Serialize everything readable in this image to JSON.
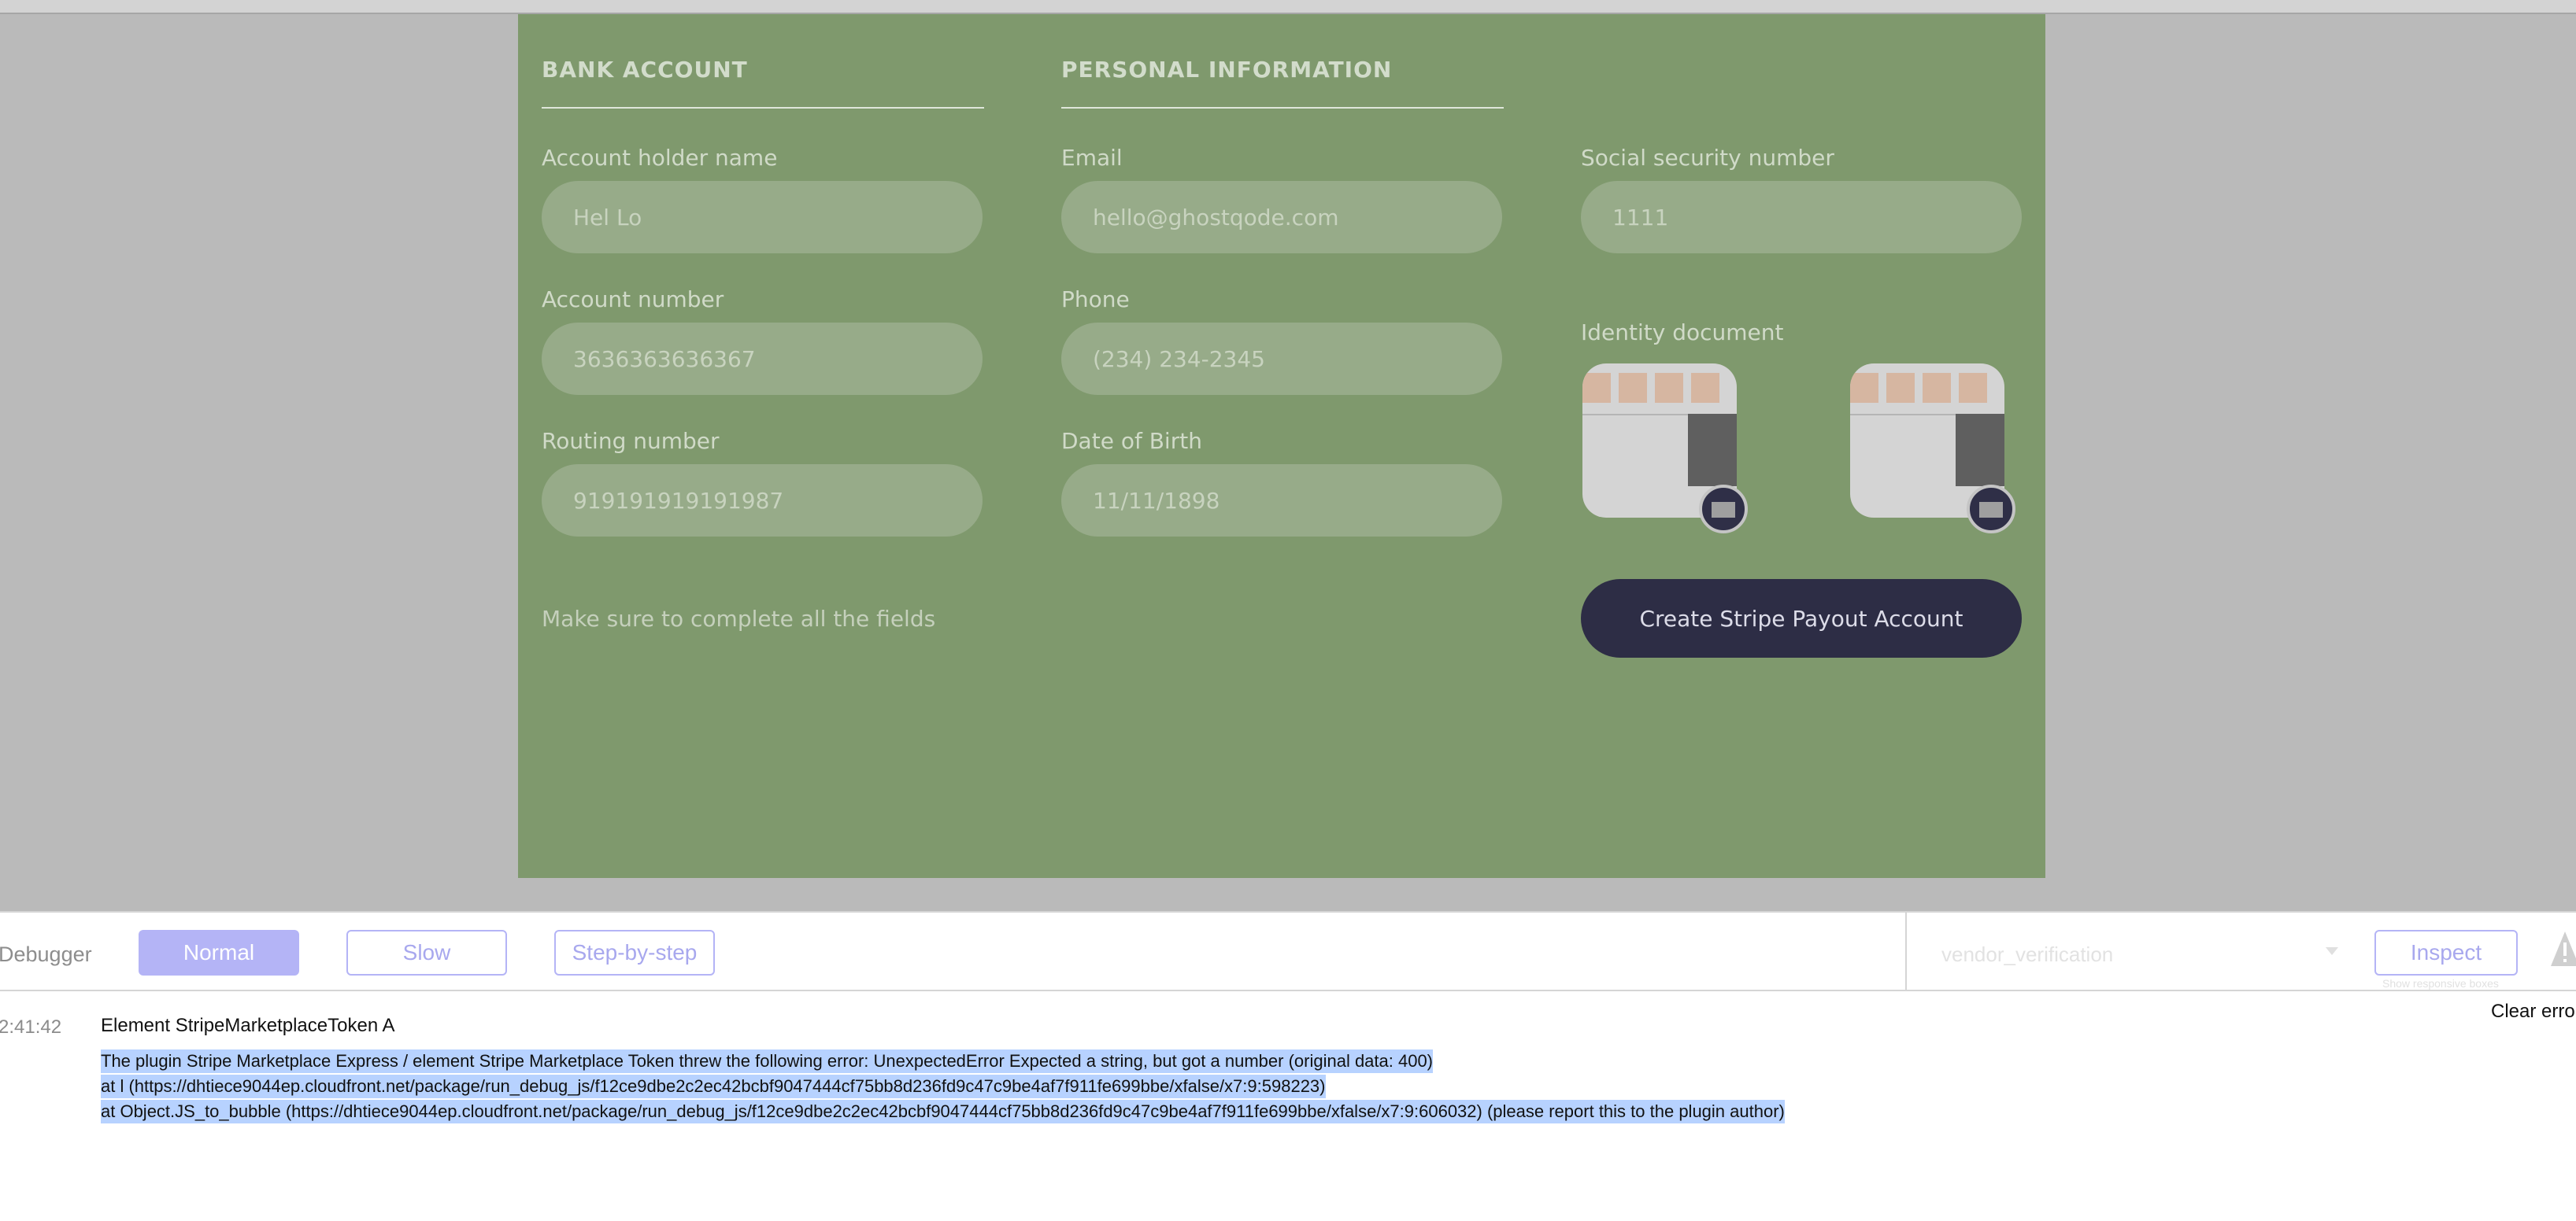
{
  "bank_account": {
    "title": "BANK ACCOUNT",
    "holder_label": "Account holder name",
    "holder_value": "Hel Lo",
    "account_label": "Account number",
    "account_value": "3636363636367",
    "routing_label": "Routing number",
    "routing_value": "919191919191987"
  },
  "personal_information": {
    "title": "PERSONAL INFORMATION",
    "email_label": "Email",
    "email_value": "hello@ghostqode.com",
    "phone_label": "Phone",
    "phone_value": "(234) 234-2345",
    "dob_label": "Date of Birth",
    "dob_value": "11/11/1898"
  },
  "identity": {
    "ssn_label": "Social security number",
    "ssn_value": "1111",
    "document_label": "Identity document"
  },
  "form": {
    "hint": "Make sure to complete all the fields",
    "submit_label": "Create Stripe Payout Account"
  },
  "debugger": {
    "title": "Debugger",
    "normal": "Normal",
    "slow": "Slow",
    "step": "Step-by-step",
    "element": "vendor_verification",
    "inspect": "Inspect",
    "responsive": "Show responsive boxes",
    "clear": "Clear errors"
  },
  "log": {
    "time": "2:41:42",
    "title": "Element StripeMarketplaceToken A",
    "line1": "The plugin Stripe Marketplace Express / element Stripe Marketplace Token threw the following error: UnexpectedError Expected a string, but got a number (original data: 400)",
    "line2": "    at l (https://dhtiece9044ep.cloudfront.net/package/run_debug_js/f12ce9dbe2c2ec42bcbf9047444cf75bb8d236fd9c47c9be4af7f911fe699bbe/xfalse/x7:9:598223)",
    "line3": "    at Object.JS_to_bubble (https://dhtiece9044ep.cloudfront.net/package/run_debug_js/f12ce9dbe2c2ec42bcbf9047444cf75bb8d236fd9c47c9be4af7f911fe699bbe/xfalse/x7:9:606032) (please report this to the plugin author)"
  },
  "colors": {
    "card": "#7f996d",
    "button": "#2d2d45",
    "debug_accent": "#b4b4f6"
  },
  "icons": [
    "warning-icon",
    "dropdown-arrow-icon"
  ]
}
